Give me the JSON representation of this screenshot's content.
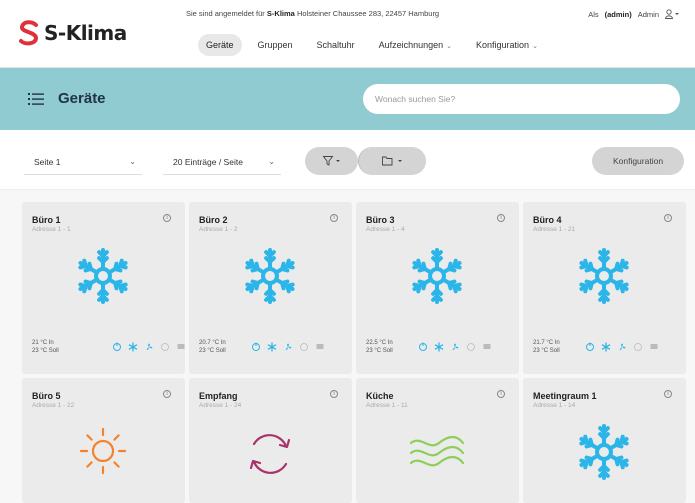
{
  "header": {
    "brand": "S-Klima",
    "login_prefix": "Sie sind angemeldet für",
    "login_company": "S-Klima",
    "login_address": "Holsteiner Chaussee 283, 22457 Hamburg",
    "user_as": "Als",
    "user_role": "(admin)",
    "user_name": "Admin",
    "nav": [
      {
        "label": "Geräte"
      },
      {
        "label": "Gruppen"
      },
      {
        "label": "Schaltuhr"
      },
      {
        "label": "Aufzeichnungen"
      },
      {
        "label": "Konfiguration"
      }
    ]
  },
  "band": {
    "title": "Geräte",
    "search_placeholder": "Wonach suchen Sie?"
  },
  "toolbar": {
    "page_select": "Seite 1",
    "per_page_select": "20 Einträge / Seite",
    "config_button": "Konfiguration"
  },
  "colors": {
    "accent": "#8fcbd1",
    "snowflake": "#2bb5e8",
    "sun": "#f5822a",
    "cycle": "#a8326b",
    "wave": "#8ccf5a"
  },
  "cards": [
    {
      "title": "Büro 1",
      "subtitle": "Adresse 1 - 1",
      "icon": "snowflake-icon",
      "temp_in": "21 °C In",
      "temp_set": "23 °C Soll"
    },
    {
      "title": "Büro 2",
      "subtitle": "Adresse 1 - 2",
      "icon": "snowflake-icon",
      "temp_in": "20.7 °C In",
      "temp_set": "23 °C Soll"
    },
    {
      "title": "Büro 3",
      "subtitle": "Adresse 1 - 4",
      "icon": "snowflake-icon",
      "temp_in": "22.5 °C In",
      "temp_set": "23 °C Soll"
    },
    {
      "title": "Büro 4",
      "subtitle": "Adresse 1 - 21",
      "icon": "snowflake-icon",
      "temp_in": "21.7 °C In",
      "temp_set": "23 °C Soll"
    },
    {
      "title": "Büro 5",
      "subtitle": "Adresse 1 - 22",
      "icon": "sun-icon"
    },
    {
      "title": "Empfang",
      "subtitle": "Adresse 1 - 24",
      "icon": "cycle-icon"
    },
    {
      "title": "Küche",
      "subtitle": "Adresse 1 - 11",
      "icon": "wave-icon"
    },
    {
      "title": "Meetingraum 1",
      "subtitle": "Adresse 1 - 14",
      "icon": "snowflake-icon"
    }
  ]
}
